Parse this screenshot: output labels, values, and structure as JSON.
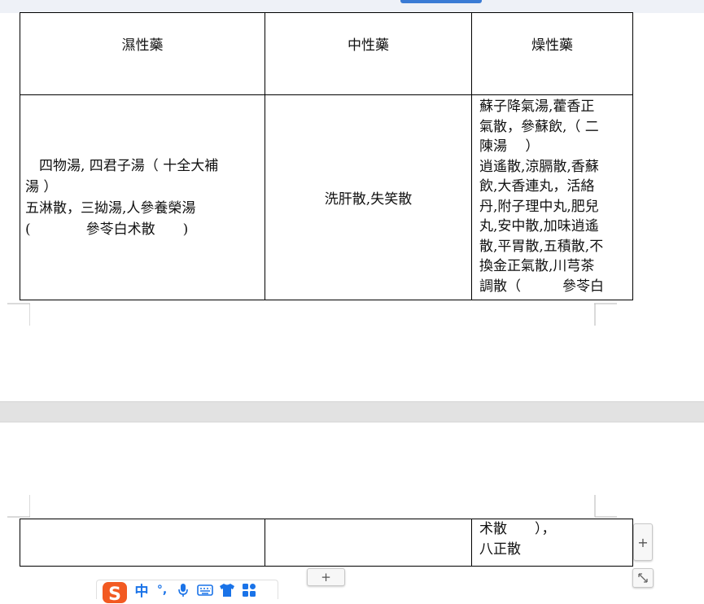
{
  "table_top": {
    "headers": [
      "濕性藥",
      "中性藥",
      "燥性藥"
    ],
    "wet_lines": [
      "　四物湯, 四君子湯（ 十全大補",
      "湯 ）",
      "五淋散，三拗湯,人參養榮湯",
      "(　　　　參苓白术散　　)"
    ],
    "neutral_text": "洗肝散,失笑散",
    "dry_lines": [
      "蘇子降氣湯,藿香正",
      "氣散，參蘇飲,（ 二",
      "陳湯　 ）",
      "逍遙散,涼膈散,香蘇",
      "飲,大香連丸，活絡",
      "丹,附子理中丸,肥兒",
      "丸,安中散,加味逍遙",
      "散,平胃散,五積散,不",
      "換金正氣散,川芎茶",
      "調散（　　　參苓白"
    ]
  },
  "table_bottom": {
    "wet_text": "",
    "neutral_text": "",
    "dry_lines": [
      "术散　　），",
      "八正散"
    ]
  },
  "controls": {
    "add_column_label": "+",
    "add_row_label": "+"
  },
  "ime_toolbar": {
    "logo_letter": "S",
    "mode_label": "中",
    "punct_label": "°,",
    "icons": [
      "microphone-icon",
      "keyboard-icon",
      "skin-shirt-icon",
      "toolbox-grid-icon"
    ]
  },
  "colors": {
    "ime_blue": "#1a73e8",
    "ime_logo_orange": "#f25a22",
    "table_border": "#000000",
    "page_gap": "#e2e2e2"
  }
}
